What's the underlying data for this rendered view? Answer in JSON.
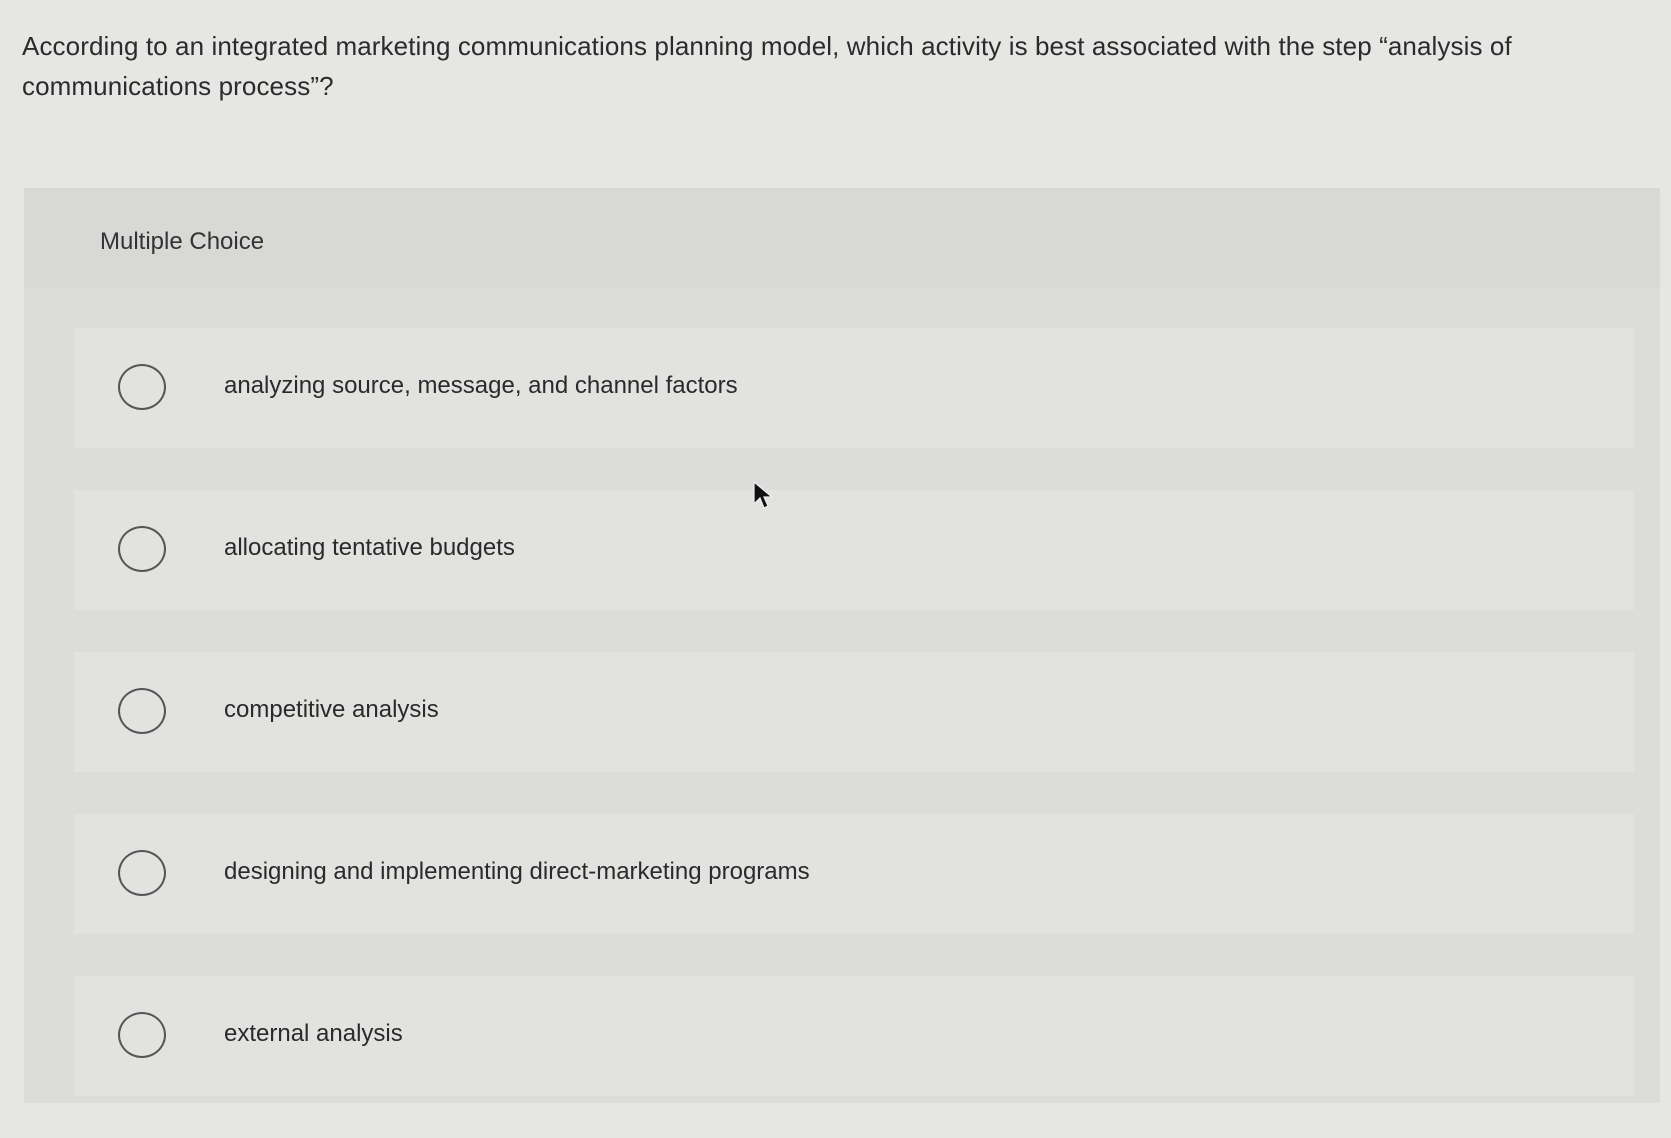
{
  "question": {
    "text": "According to an integrated marketing communications planning model, which activity is best associated with the step “analysis of communications process”?"
  },
  "multiple_choice": {
    "label": "Multiple Choice",
    "options": [
      {
        "text": "analyzing source, message, and channel factors",
        "selected": false
      },
      {
        "text": "allocating tentative budgets",
        "selected": false
      },
      {
        "text": "competitive analysis",
        "selected": false
      },
      {
        "text": "designing and implementing direct-marketing programs",
        "selected": false
      },
      {
        "text": "external analysis",
        "selected": false
      }
    ]
  },
  "icons": {
    "radio": "radio-unchecked-icon",
    "cursor": "mouse-pointer-icon"
  },
  "colors": {
    "background": "#e6e6e4",
    "panel": "#dcdcda",
    "text": "#2a2a2a",
    "radio_border": "#555555"
  }
}
